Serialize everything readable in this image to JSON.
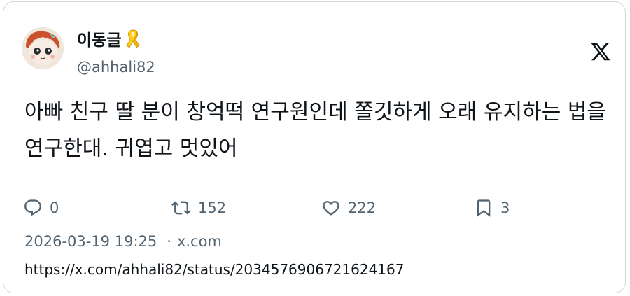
{
  "tweet": {
    "display_name": "이동글",
    "handle": "@ahhali82",
    "text": "아빠 친구 딸 분이 창억떡 연구원인데 쫄깃하게 오래 유지하는 법을 연구한대. 귀엽고 멋있어",
    "timestamp": "2026-03-19 19:25",
    "separator": "·",
    "source": "x.com",
    "url": "https://x.com/ahhali82/status/2034576906721624167"
  },
  "stats": {
    "replies": "0",
    "retweets": "152",
    "likes": "222",
    "bookmarks": "3"
  },
  "icons": {
    "avatar": "avatar-image",
    "badge": "yellow-ribbon-icon",
    "platform": "x-logo-icon",
    "reply": "reply-icon",
    "retweet": "retweet-icon",
    "like": "heart-icon",
    "bookmark": "bookmark-icon"
  },
  "colors": {
    "text": "#0f1419",
    "secondary": "#536471",
    "border": "#cfd9de",
    "ribbon": "#f2b705"
  }
}
